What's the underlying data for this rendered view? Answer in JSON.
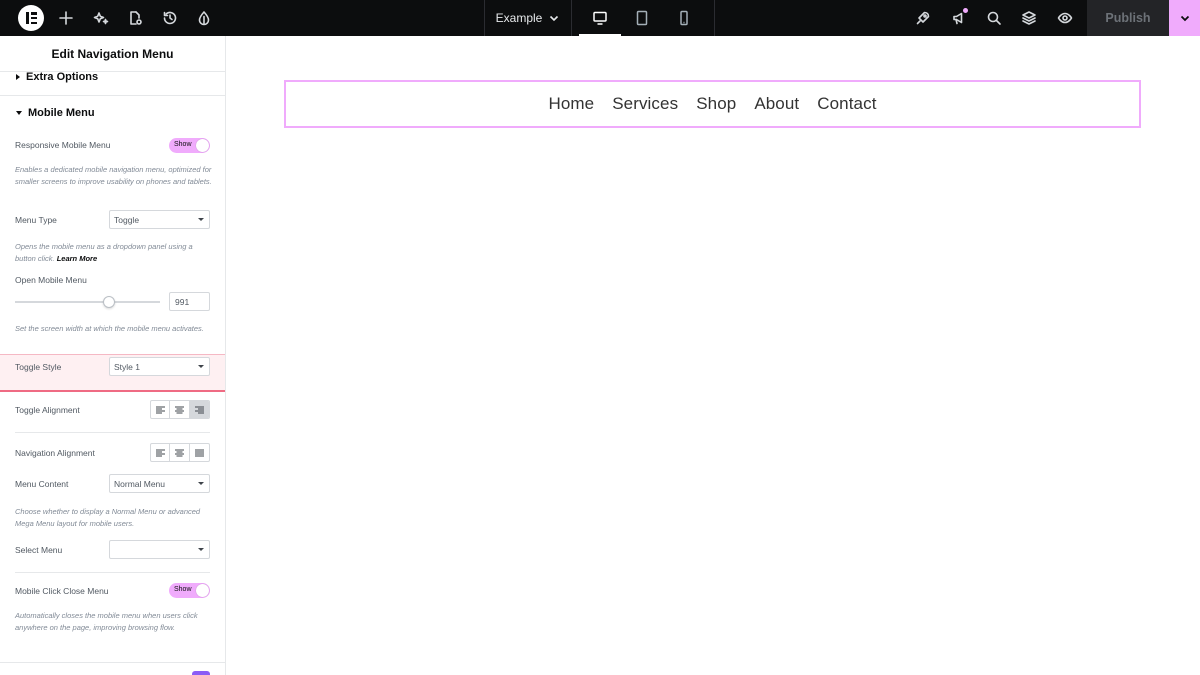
{
  "topbar": {
    "document_title": "Example",
    "publish_label": "Publish",
    "colors": {
      "background": "#0c0d0e",
      "accent": "#f0abfc"
    },
    "icons": [
      "elementor-logo-icon",
      "add-element-icon",
      "ai-sparkle-icon",
      "page-settings-icon",
      "history-icon",
      "site-settings-icon",
      "rocket-icon",
      "notifications-icon",
      "search-icon",
      "structure-layers-icon",
      "preview-eye-icon"
    ]
  },
  "panel": {
    "title": "Edit Navigation Menu",
    "extra_options_label": "Extra Options",
    "mobile_menu_label": "Mobile Menu",
    "responsive": {
      "label": "Responsive Mobile Menu",
      "toggle": "Show",
      "desc": "Enables a dedicated mobile navigation menu, optimized for smaller screens to improve usability on phones and tablets."
    },
    "menu_type": {
      "label": "Menu Type",
      "value": "Toggle",
      "desc": "Opens the mobile menu as a dropdown panel using a button click.",
      "learn_more": "Learn More"
    },
    "open_mobile_menu": {
      "label": "Open Mobile Menu",
      "value": "991",
      "slider_fraction": 0.65,
      "desc": "Set the screen width at which the mobile menu activates."
    },
    "toggle_style": {
      "label": "Toggle Style",
      "value": "Style 1"
    },
    "toggle_alignment": {
      "label": "Toggle Alignment",
      "selected": "right"
    },
    "navigation_alignment": {
      "label": "Navigation Alignment"
    },
    "menu_content": {
      "label": "Menu Content",
      "value": "Normal Menu",
      "desc": "Choose whether to display a Normal Menu or advanced Mega Menu layout for mobile users."
    },
    "select_menu": {
      "label": "Select Menu",
      "value": ""
    },
    "mobile_click_close": {
      "label": "Mobile Click Close Menu",
      "toggle": "Show",
      "desc": "Automatically closes the mobile menu when users click anywhere on the page, improving browsing flow."
    }
  },
  "canvas": {
    "nav_items": [
      "Home",
      "Services",
      "Shop",
      "About",
      "Contact"
    ]
  }
}
